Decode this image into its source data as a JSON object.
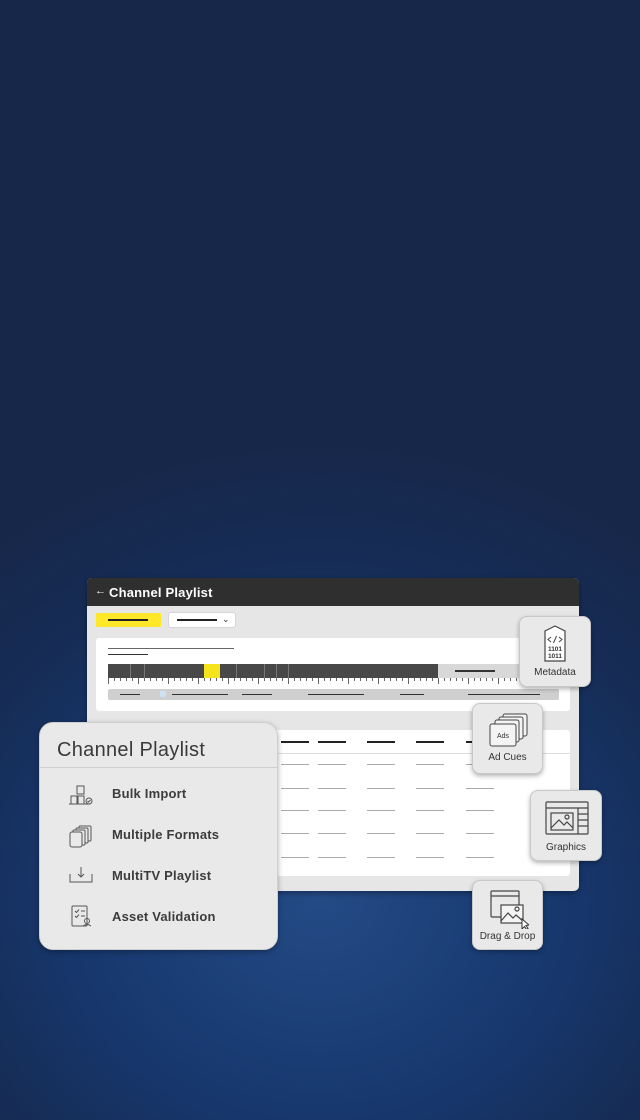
{
  "window": {
    "back_icon": "arrow-left-icon",
    "title": "Channel Playlist"
  },
  "card": {
    "title": "Channel Playlist",
    "features": [
      {
        "label": "Bulk Import",
        "icon": "bulk-import-icon"
      },
      {
        "label": "Multiple Formats",
        "icon": "stacked-layers-icon"
      },
      {
        "label": "MultiTV Playlist",
        "icon": "download-tray-icon"
      },
      {
        "label": "Asset Validation",
        "icon": "checklist-icon"
      }
    ]
  },
  "badges": {
    "metadata": {
      "label": "Metadata",
      "icon": "code-tag-icon",
      "icon_text_1": "1101",
      "icon_text_2": "1011"
    },
    "ad_cues": {
      "label": "Ad Cues",
      "icon": "ads-stack-icon",
      "icon_text": "Ads"
    },
    "graphics": {
      "label": "Graphics",
      "icon": "image-window-icon"
    },
    "drag_drop": {
      "label": "Drag & Drop",
      "icon": "drag-drop-image-icon"
    }
  },
  "colors": {
    "background_top": "#17274a",
    "background_center": "#244a85",
    "titlebar": "#2f2f2f",
    "accent_yellow": "#ffe82a",
    "panel": "#e6e6e6"
  }
}
